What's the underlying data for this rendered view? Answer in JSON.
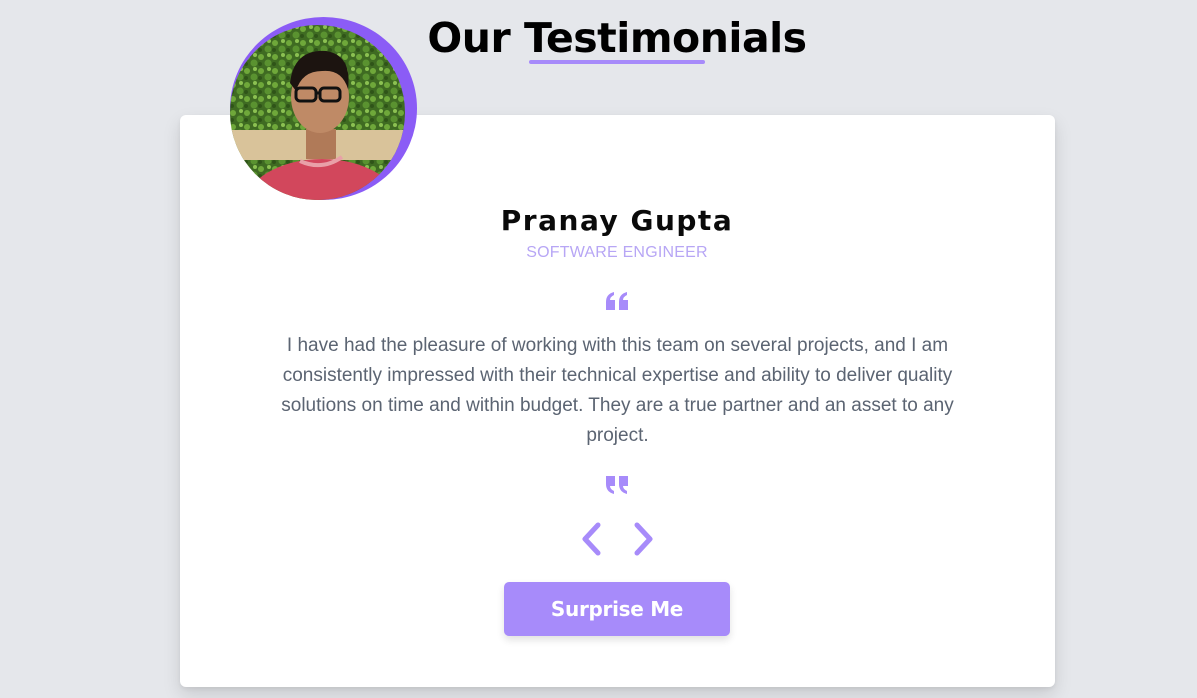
{
  "section": {
    "heading": "Our Testimonials"
  },
  "testimonial": {
    "name": "Pranay Gupta",
    "role": "SOFTWARE ENGINEER",
    "text": "I have had the pleasure of working with this team on several projects, and I am consistently impressed with their technical expertise and ability to deliver quality solutions on time and within budget. They are a true partner and an asset to any project."
  },
  "controls": {
    "prev_icon": "chevron-left",
    "next_icon": "chevron-right",
    "surprise_label": "Surprise Me"
  },
  "icons": {
    "open_quote": "quote-left",
    "close_quote": "quote-right"
  },
  "colors": {
    "accent": "#a78bfa",
    "accent_strong": "#8b5cf6",
    "role": "#b7a6f5",
    "body_text": "#5b6472",
    "background": "#e5e7eb",
    "card": "#ffffff"
  }
}
